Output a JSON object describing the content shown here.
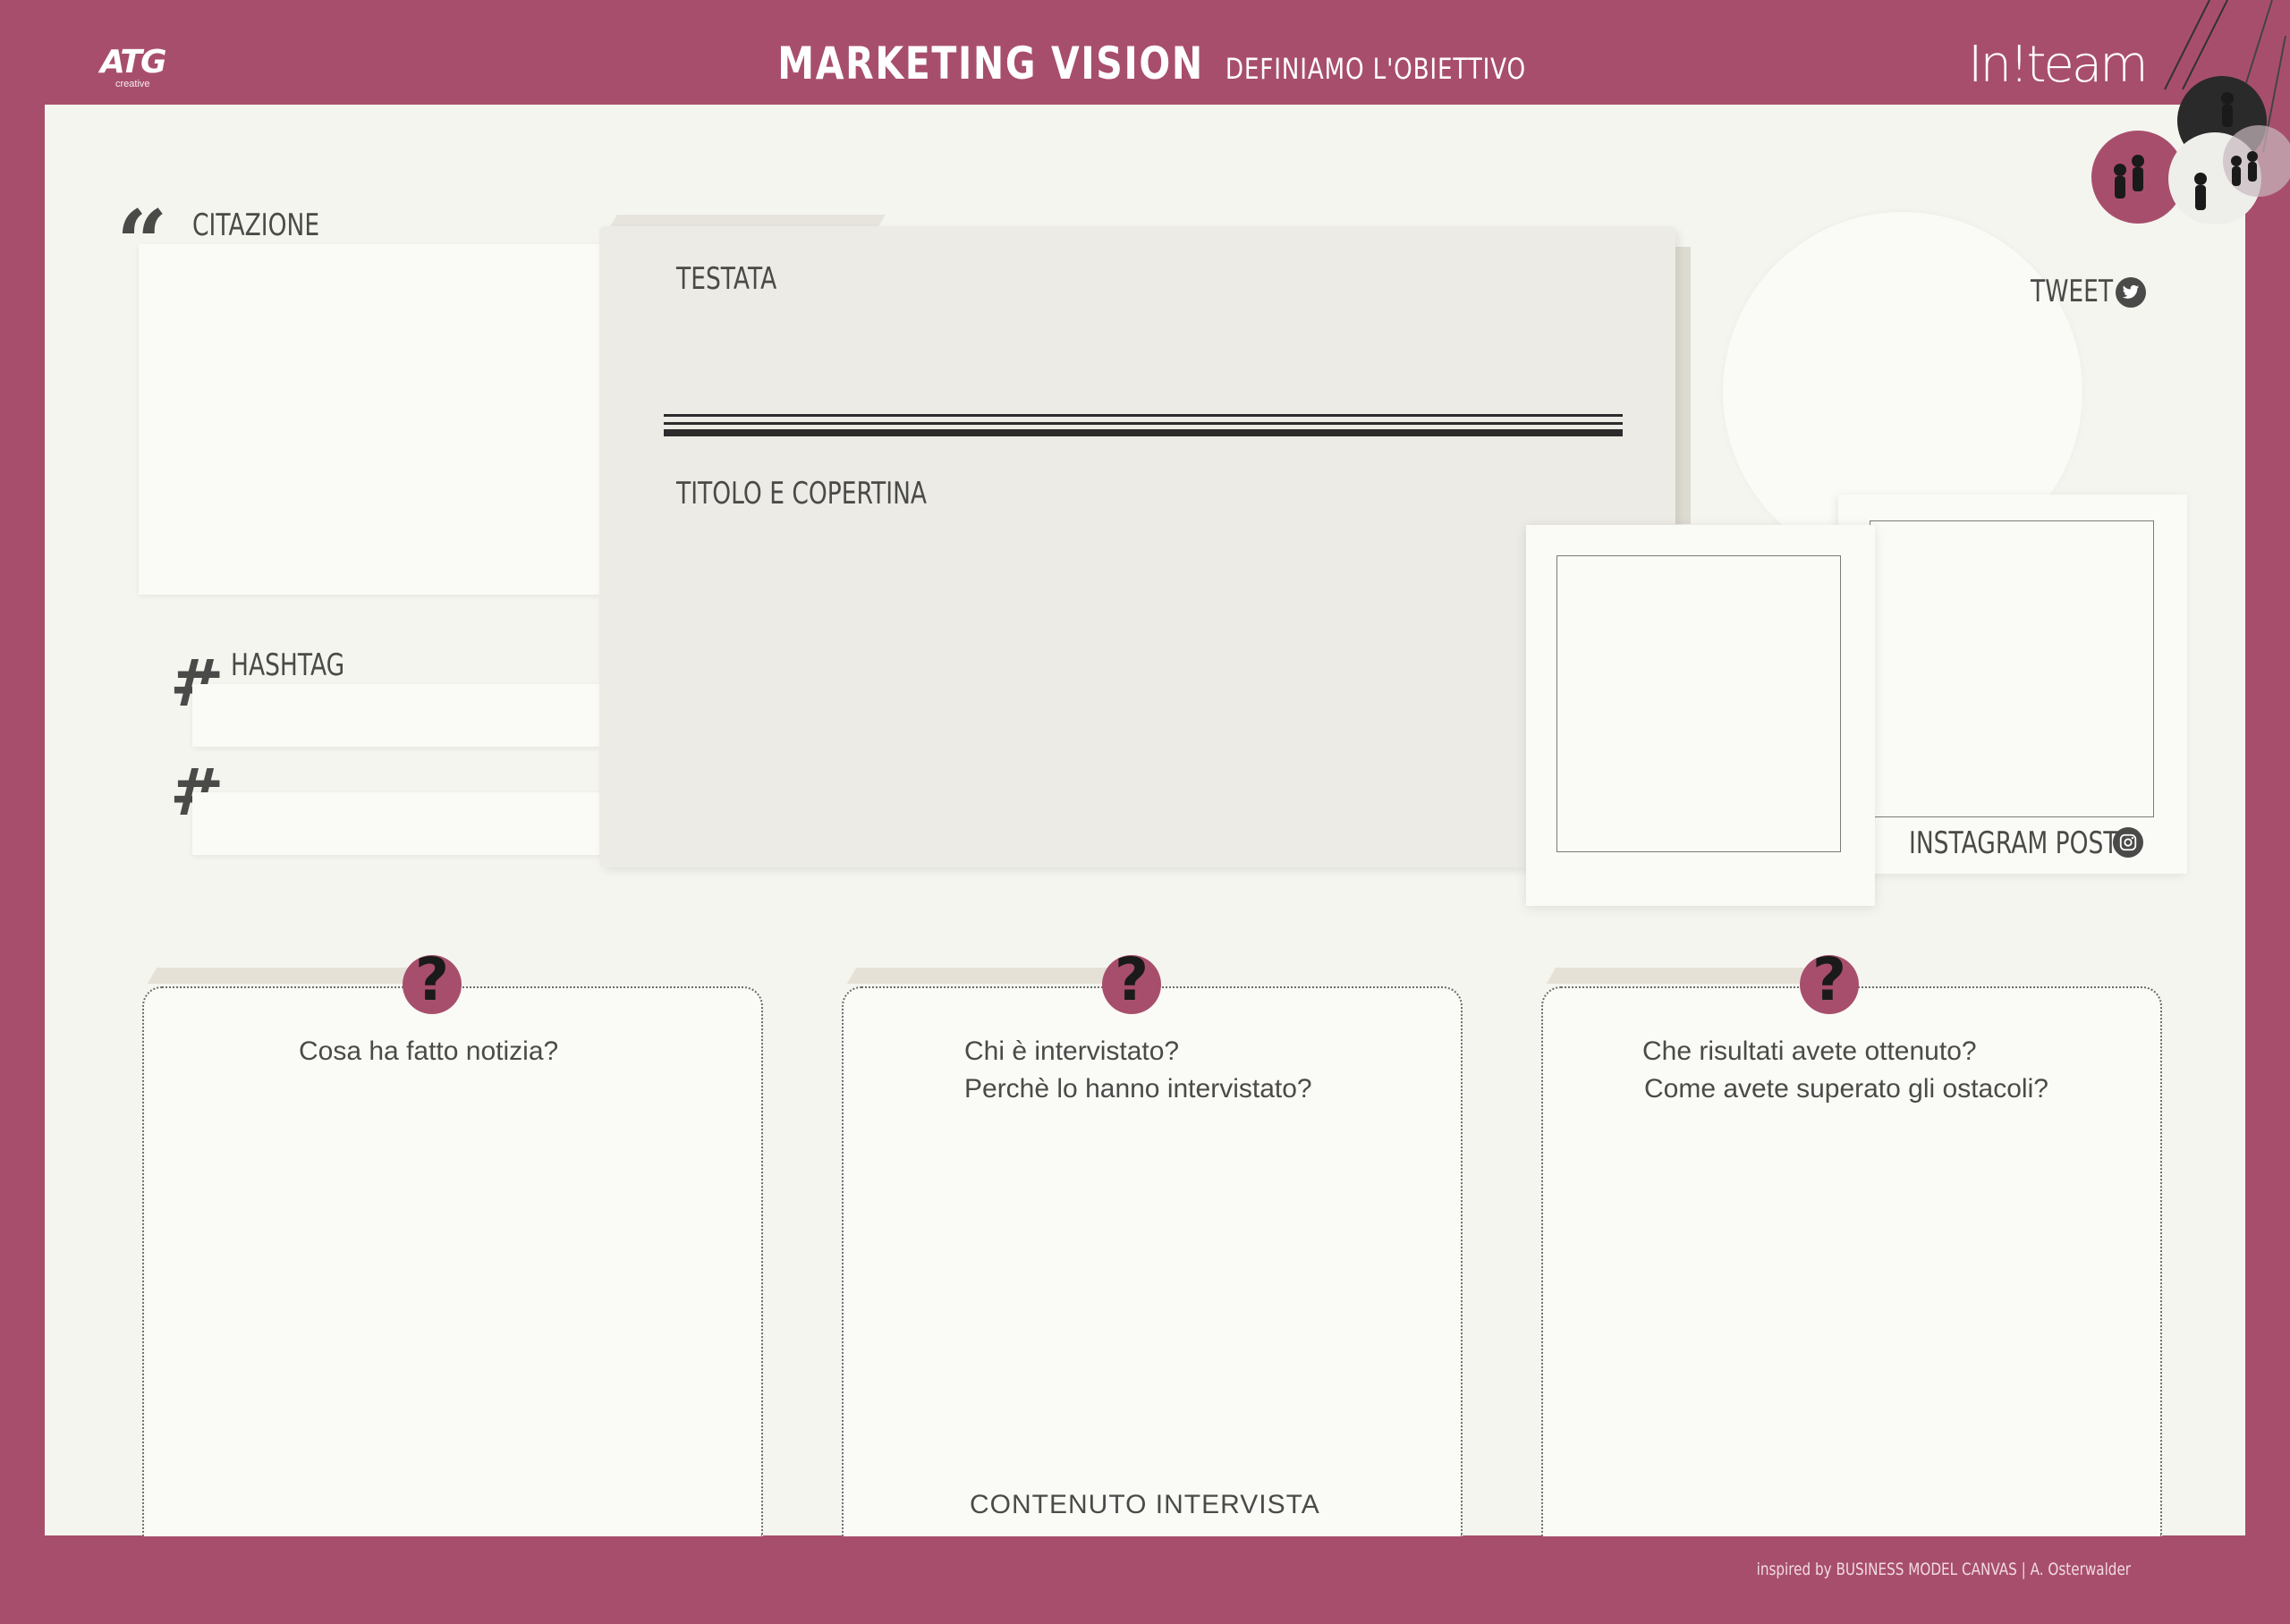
{
  "header": {
    "logo_left": "ATG",
    "logo_left_sub": "creative",
    "title_main": "MARKETING VISION",
    "title_sub": "DEFINIAMO L'OBIETTIVO",
    "logo_right": "In!team"
  },
  "sections": {
    "citazione": "CITAZIONE",
    "hashtag": "HASHTAG",
    "hash_symbol": "#",
    "quote_symbol": "“",
    "testata": "TESTATA",
    "titolo": "TITOLO E COPERTINA",
    "tweet": "TWEET",
    "instagram": "INSTAGRAM POST"
  },
  "questions": [
    {
      "line1": "Cosa ha fatto notizia?",
      "line2": ""
    },
    {
      "line1": "Chi è intervistato?",
      "line2": "Perchè lo hanno intervistato?"
    },
    {
      "line1": "Che risultati avete ottenuto?",
      "line2": "Come avete superato gli ostacoli?"
    }
  ],
  "question_mark": "?",
  "contenuto": "CONTENUTO INTERVISTA",
  "footer": "inspired by BUSINESS MODEL CANVAS | A. Osterwalder",
  "colors": {
    "brand": "#a84e6d",
    "board": "#f5f5ef",
    "ink": "#4a4a48"
  },
  "icons": [
    "twitter-icon",
    "instagram-icon",
    "people-illustration"
  ]
}
